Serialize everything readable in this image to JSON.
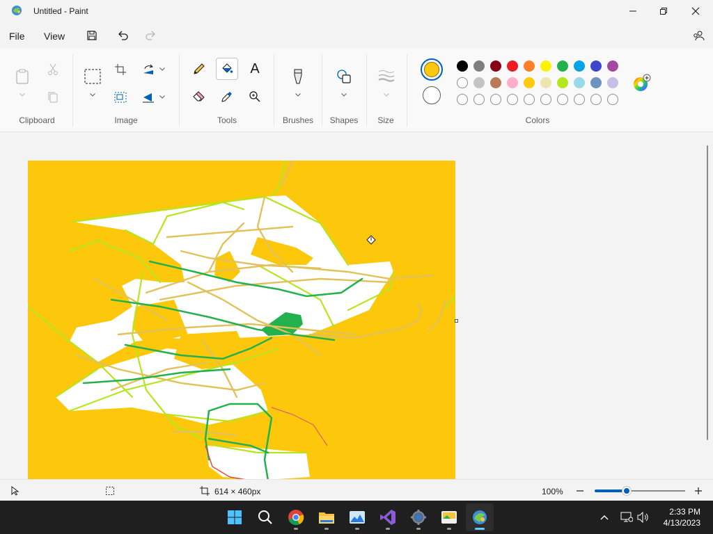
{
  "window": {
    "title": "Untitled - Paint"
  },
  "menu": {
    "file": "File",
    "view": "View"
  },
  "ribbon": {
    "groups": {
      "clipboard": "Clipboard",
      "image": "Image",
      "tools": "Tools",
      "brushes": "Brushes",
      "shapes": "Shapes",
      "size": "Size",
      "colors": "Colors"
    },
    "text_tool": "A"
  },
  "colors": {
    "primary": "#fdc70c",
    "secondary": "#ffffff",
    "palette_row1": [
      "#000000",
      "#7f7f7f",
      "#880015",
      "#ed1c24",
      "#ff7f27",
      "#fff200",
      "#22b14c",
      "#00a2e8",
      "#3f48cc",
      "#a349a4"
    ],
    "palette_row2": [
      "#ffffff",
      "#c3c3c3",
      "#b97a57",
      "#ffaec9",
      "#ffc90e",
      "#efe4b0",
      "#b5e61d",
      "#99d9ea",
      "#7092be",
      "#c8bfe7"
    ]
  },
  "status": {
    "canvas_size": "614 × 460px",
    "zoom": "100%",
    "zoom_fraction": 0.35
  },
  "taskbar": {
    "time": "2:33 PM",
    "date": "4/13/2023"
  }
}
